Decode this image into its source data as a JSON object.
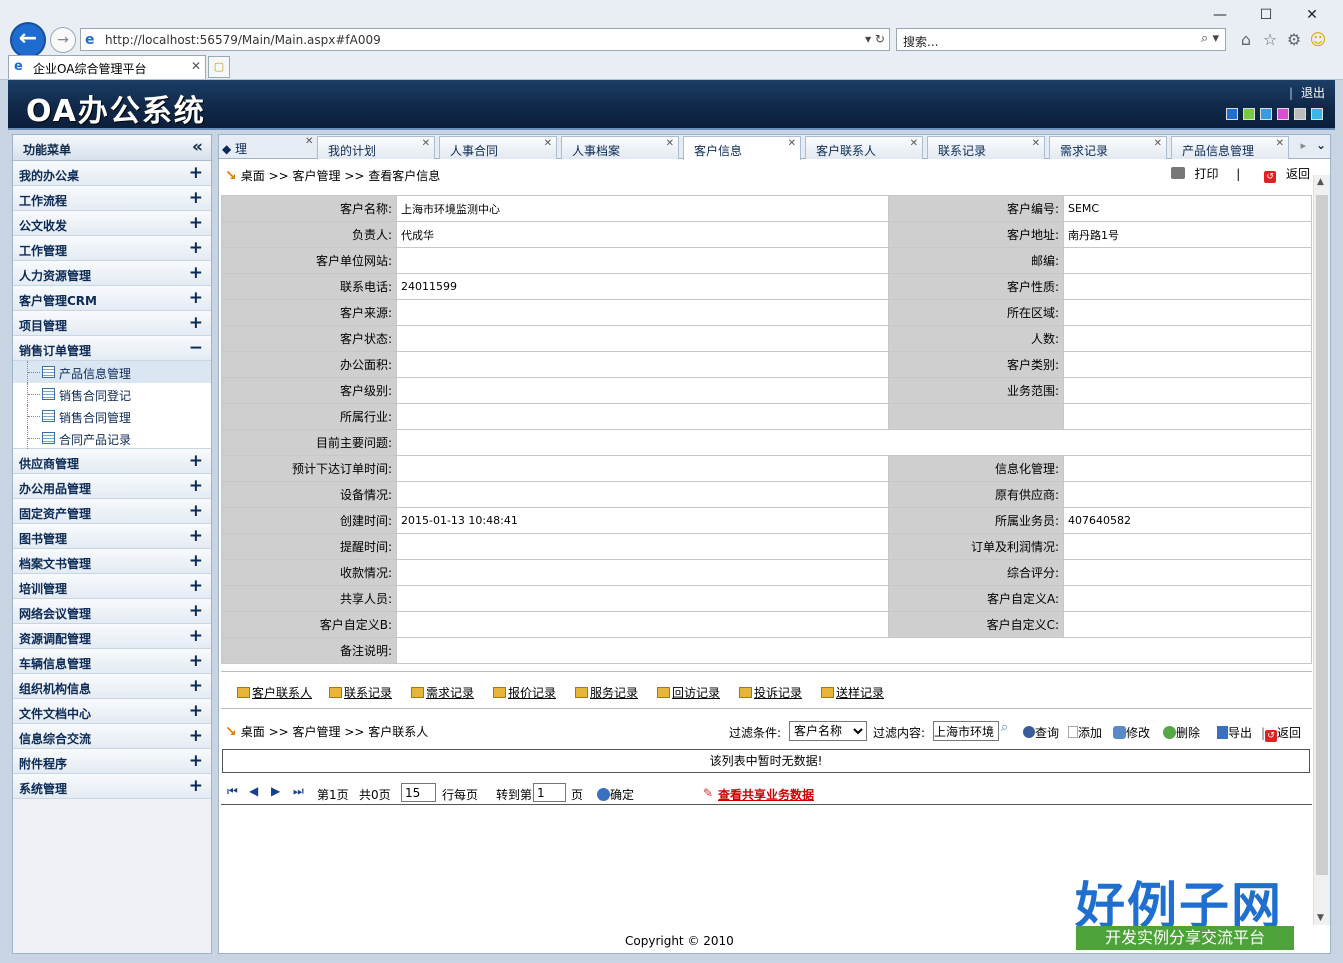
{
  "browser": {
    "url": "http://localhost:56579/Main/Main.aspx#fA009",
    "search_placeholder": "搜索...",
    "tab_title": "企业OA综合管理平台"
  },
  "header": {
    "title": "OA办公系统",
    "logout": "退出",
    "swatch_colors": [
      "#1a6fcf",
      "#7ac943",
      "#3a9be0",
      "#d84fd0",
      "#bbbbbb",
      "#3ab7e8"
    ]
  },
  "sidebar": {
    "title": "功能菜单",
    "items": [
      {
        "label": "我的办公桌"
      },
      {
        "label": "工作流程"
      },
      {
        "label": "公文收发"
      },
      {
        "label": "工作管理"
      },
      {
        "label": "人力资源管理"
      },
      {
        "label": "客户管理CRM"
      },
      {
        "label": "项目管理"
      },
      {
        "label": "销售订单管理"
      }
    ],
    "subitems": [
      {
        "label": "产品信息管理"
      },
      {
        "label": "销售合同登记"
      },
      {
        "label": "销售合同管理"
      },
      {
        "label": "合同产品记录"
      }
    ],
    "items2": [
      {
        "label": "供应商管理"
      },
      {
        "label": "办公用品管理"
      },
      {
        "label": "固定资产管理"
      },
      {
        "label": "图书管理"
      },
      {
        "label": "档案文书管理"
      },
      {
        "label": "培训管理"
      },
      {
        "label": "网络会议管理"
      },
      {
        "label": "资源调配管理"
      },
      {
        "label": "车辆信息管理"
      },
      {
        "label": "组织机构信息"
      },
      {
        "label": "文件文档中心"
      },
      {
        "label": "信息综合交流"
      },
      {
        "label": "附件程序"
      },
      {
        "label": "系统管理"
      }
    ]
  },
  "tabs": {
    "first_partial": "理",
    "items": [
      {
        "label": "我的计划"
      },
      {
        "label": "人事合同"
      },
      {
        "label": "人事档案"
      },
      {
        "label": "客户信息"
      },
      {
        "label": "客户联系人"
      },
      {
        "label": "联系记录"
      },
      {
        "label": "需求记录"
      },
      {
        "label": "产品信息管理"
      }
    ]
  },
  "breadcrumb": {
    "home": "桌面",
    "sep": ">>",
    "level1": "客户管理",
    "level2": "查看客户信息"
  },
  "actions": {
    "print": "打印",
    "back": "返回"
  },
  "customer": {
    "rows": [
      {
        "l1": "客户名称:",
        "v1": "上海市环境监测中心",
        "l2": "客户编号:",
        "v2": "SEMC"
      },
      {
        "l1": "负责人:",
        "v1": "代成华",
        "l2": "客户地址:",
        "v2": "南丹路1号"
      },
      {
        "l1": "客户单位网站:",
        "v1": "",
        "l2": "邮编:",
        "v2": ""
      },
      {
        "l1": "联系电话:",
        "v1": "24011599",
        "l2": "客户性质:",
        "v2": ""
      },
      {
        "l1": "客户来源:",
        "v1": "",
        "l2": "所在区域:",
        "v2": ""
      },
      {
        "l1": "客户状态:",
        "v1": "",
        "l2": "人数:",
        "v2": ""
      },
      {
        "l1": "办公面积:",
        "v1": "",
        "l2": "客户类别:",
        "v2": ""
      },
      {
        "l1": "客户级别:",
        "v1": "",
        "l2": "业务范围:",
        "v2": ""
      },
      {
        "l1": "所属行业:",
        "v1": "",
        "l2": "",
        "v2": ""
      },
      {
        "l1": "目前主要问题:",
        "v1": "",
        "full": true
      },
      {
        "l1": "预计下达订单时间:",
        "v1": "",
        "l2": "信息化管理:",
        "v2": ""
      },
      {
        "l1": "设备情况:",
        "v1": "",
        "l2": "原有供应商:",
        "v2": ""
      },
      {
        "l1": "创建时间:",
        "v1": "2015-01-13 10:48:41",
        "l2": "所属业务员:",
        "v2": "407640582"
      },
      {
        "l1": "提醒时间:",
        "v1": "",
        "l2": "订单及利润情况:",
        "v2": ""
      },
      {
        "l1": "收款情况:",
        "v1": "",
        "l2": "综合评分:",
        "v2": ""
      },
      {
        "l1": "共享人员:",
        "v1": "",
        "l2": "客户自定义A:",
        "v2": ""
      },
      {
        "l1": "客户自定义B:",
        "v1": "",
        "l2": "客户自定义C:",
        "v2": ""
      },
      {
        "l1": "备注说明:",
        "v1": "",
        "full": true
      }
    ]
  },
  "related_links": [
    {
      "label": "客户联系人"
    },
    {
      "label": "联系记录"
    },
    {
      "label": "需求记录"
    },
    {
      "label": "报价记录"
    },
    {
      "label": "服务记录"
    },
    {
      "label": "回访记录"
    },
    {
      "label": "投诉记录"
    },
    {
      "label": "送样记录"
    }
  ],
  "sub_breadcrumb": {
    "home": "桌面",
    "sep": ">>",
    "level1": "客户管理",
    "level2": "客户联系人"
  },
  "filter": {
    "condition_label": "过滤条件:",
    "condition_value": "客户名称",
    "content_label": "过滤内容:",
    "content_value": "上海市环境",
    "query": "查询",
    "add": "添加",
    "edit": "修改",
    "delete": "删除",
    "export": "导出",
    "back": "返回"
  },
  "list": {
    "empty_text": "该列表中暂时无数据!"
  },
  "pager": {
    "page_text": "第1页",
    "total_text": "共0页",
    "page_size": "15",
    "per_page": "行每页",
    "goto_label": "转到第",
    "goto_value": "1",
    "page_unit": "页",
    "confirm": "确定",
    "share_link": "查看共享业务数据"
  },
  "footer": {
    "copyright": "Copyright © 2010"
  },
  "watermark": {
    "logo": "好例子网",
    "slogan": "开发实例分享交流平台"
  }
}
